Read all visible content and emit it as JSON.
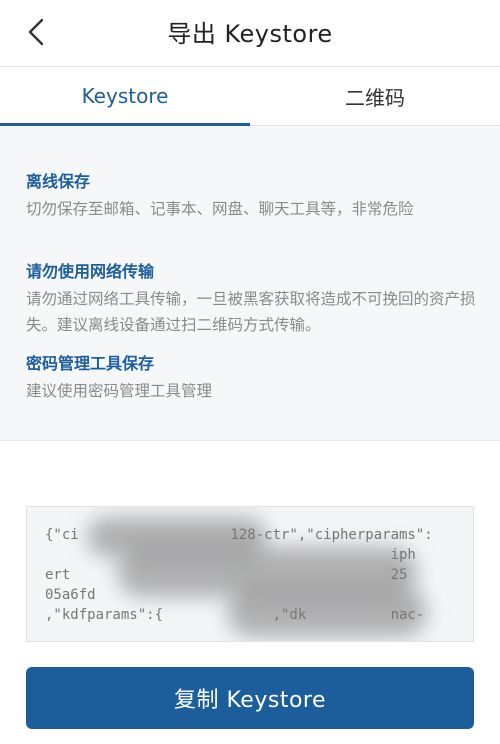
{
  "header": {
    "title": "导出 Keystore"
  },
  "tabs": [
    {
      "label": "Keystore",
      "active": true
    },
    {
      "label": "二维码",
      "active": false
    }
  ],
  "tips": [
    {
      "title": "离线保存",
      "desc": "切勿保存至邮箱、记事本、网盘、聊天工具等，非常危险"
    },
    {
      "title": "请勿使用网络传输",
      "desc": "请勿通过网络工具传输，一旦被黑客获取将造成不可挽回的资产损失。建议离线设备通过扫二维码方式传输。"
    },
    {
      "title": "密码管理工具保存",
      "desc": "建议使用密码管理工具管理"
    }
  ],
  "keystore": {
    "text": "{\"ci                  128-ctr\",\"cipherparams\":\n                                         iph\nert                                      25\n05a6fd                               \n,\"kdfparams\":{             ,\"dk          nac-"
  },
  "actions": {
    "copy_label": "复制 Keystore"
  },
  "colors": {
    "accent": "#1c5e9c",
    "info_bg": "#f6f7f9",
    "desc_text": "#8a8a8a"
  }
}
